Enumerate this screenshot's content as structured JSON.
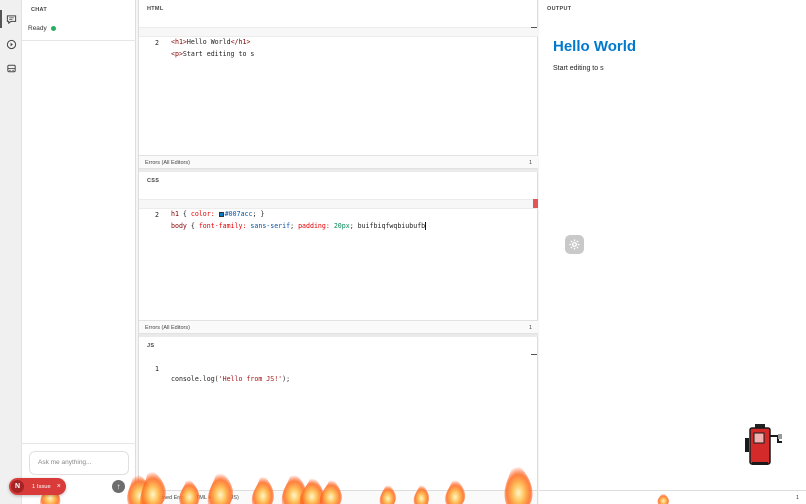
{
  "rail": {
    "icons": [
      "chat-icon",
      "history-icon",
      "robot-icon"
    ]
  },
  "chat": {
    "label": "CHAT",
    "status": "Ready",
    "input_placeholder": "Ask me anything...",
    "status_color": "#27ae60"
  },
  "html_pane": {
    "label": "HTML",
    "lines": [
      {
        "num": "1",
        "open": "<h1>",
        "text": "Hello World",
        "close": "</h1>"
      },
      {
        "num": "2",
        "open": "<p>",
        "text": "Start editing to s"
      }
    ],
    "errors_label": "Errors (All Editors)",
    "errors_count": "1"
  },
  "css_pane": {
    "label": "CSS",
    "line1": {
      "num": "1",
      "selector": "h1",
      "open": " { ",
      "prop": "color:",
      "value": "#007acc",
      "close": "; }"
    },
    "line2": {
      "num": "2",
      "selector": "body",
      "open": " { ",
      "prop1": "font-family:",
      "value1": " sans-serif",
      "sep1": ";",
      "prop2": " padding:",
      "value2": " 20px",
      "rest": "; buifbiqfwqbiubufb"
    },
    "errors_label": "Errors (All Editors)",
    "errors_count": "1"
  },
  "js_pane": {
    "label": "JS",
    "line1": {
      "num": "1",
      "pre": "console.log(",
      "str": "'Hello from JS!'",
      "post": ");"
    }
  },
  "output": {
    "label": "OUTPUT",
    "heading": "Hello World",
    "paragraph": "Start editing to s",
    "heading_color": "#007acc",
    "bottom_count": "1"
  },
  "combined_errors": {
    "label": "Combined Errors (HTML + CSS + JS)"
  },
  "issue_badge": {
    "logo": "N",
    "text": "1 Issue",
    "close": "×",
    "color": "#d93b3b"
  },
  "send_button": {
    "glyph": "↑"
  }
}
